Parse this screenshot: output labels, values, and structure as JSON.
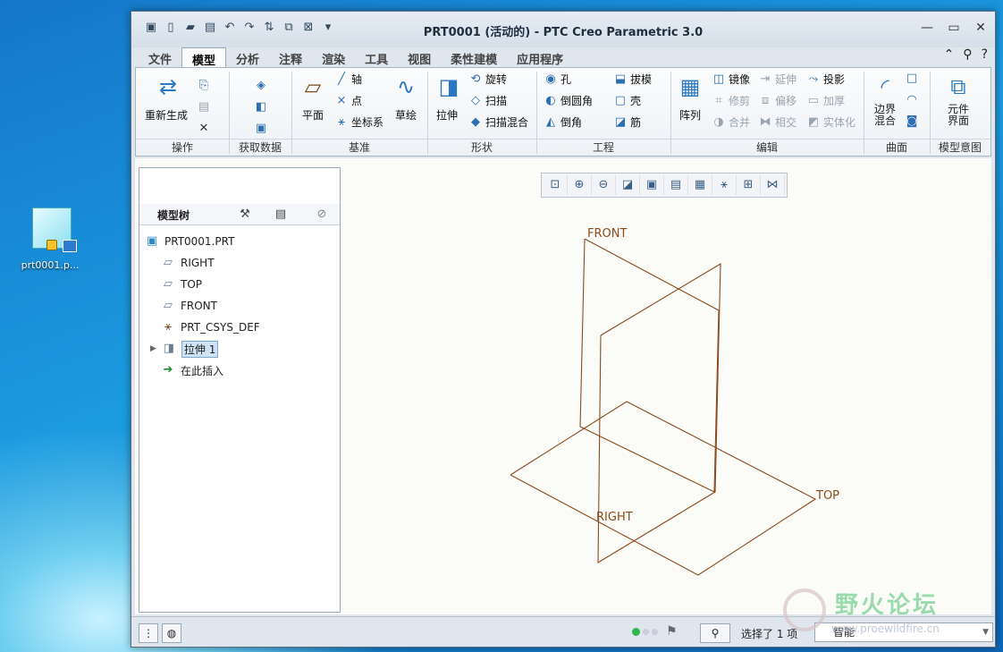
{
  "desktop": {
    "icon_label": "prt0001.p..."
  },
  "window": {
    "title": "PRT0001 (活动的) - PTC Creo Parametric 3.0"
  },
  "tabs": [
    "文件",
    "模型",
    "分析",
    "注释",
    "渲染",
    "工具",
    "视图",
    "柔性建模",
    "应用程序"
  ],
  "ribbon": {
    "regen": "重新生成",
    "plane": "平面",
    "axis": "轴",
    "point": "点",
    "csys": "坐标系",
    "sketch": "草绘",
    "extrude": "拉伸",
    "revolve": "旋转",
    "sweep": "扫描",
    "swept_blend": "扫描混合",
    "hole": "孔",
    "round": "倒圆角",
    "chamfer": "倒角",
    "draft": "拔模",
    "shell": "壳",
    "rib": "筋",
    "pattern": "阵列",
    "mirror": "镜像",
    "trim": "修剪",
    "merge": "合并",
    "extend": "延伸",
    "offset": "偏移",
    "intersect": "相交",
    "project": "投影",
    "thicken": "加厚",
    "solidify": "实体化",
    "boundary_blend_1": "边界",
    "boundary_blend_2": "混合",
    "component_interface_1": "元件",
    "component_interface_2": "界面",
    "groups": [
      "操作",
      "获取数据",
      "基准",
      "形状",
      "工程",
      "编辑",
      "曲面",
      "模型意图"
    ]
  },
  "model_tree": {
    "header": "模型树",
    "items": [
      "PRT0001.PRT",
      "RIGHT",
      "TOP",
      "FRONT",
      "PRT_CSYS_DEF",
      "拉伸 1",
      "在此插入"
    ]
  },
  "graphics": {
    "labels": [
      "FRONT",
      "TOP",
      "RIGHT"
    ],
    "line_color": "#8b4a1c"
  },
  "status": {
    "selected": "选择了 1 项",
    "filter": "智能"
  },
  "watermark": {
    "text": "野火论坛",
    "url": "www.proewildfire.cn"
  }
}
